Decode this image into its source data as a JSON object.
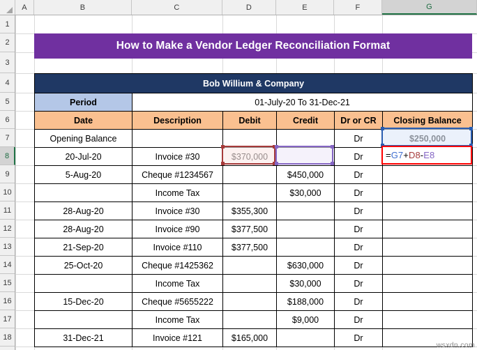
{
  "spreadsheet": {
    "column_headers": [
      "A",
      "B",
      "C",
      "D",
      "E",
      "F",
      "G"
    ],
    "active_column": "G",
    "active_row": "8",
    "row_headers": [
      "1",
      "2",
      "3",
      "4",
      "5",
      "6",
      "7",
      "8",
      "9",
      "10",
      "11",
      "12",
      "13",
      "14",
      "15",
      "16",
      "17",
      "18"
    ],
    "corner_select_all": "select-all-corner"
  },
  "banner": {
    "title": "How to Make a Vendor Ledger Reconciliation Format",
    "color": "#7030A0"
  },
  "table": {
    "company_name": "Bob Willium & Company",
    "company_bar_color": "#1F3864",
    "period_label": "Period",
    "period_label_color": "#B4C7E7",
    "period_value": "01-July-20 To 31-Dec-21",
    "header_color": "#FAC090",
    "columns": [
      "Date",
      "Description",
      "Debit",
      "Credit",
      "Dr or CR",
      "Closing Balance"
    ],
    "rows": [
      {
        "row": "7",
        "date": "Opening Balance",
        "description": "",
        "debit": "",
        "credit": "",
        "drcr": "Dr",
        "closing": "$250,000"
      },
      {
        "row": "8",
        "date": "20-Jul-20",
        "description": "Invoice #30",
        "debit": "$370,000",
        "credit": "",
        "drcr": "Dr",
        "closing": ""
      },
      {
        "row": "9",
        "date": "5-Aug-20",
        "description": "Cheque #1234567",
        "debit": "",
        "credit": "$450,000",
        "drcr": "Dr",
        "closing": ""
      },
      {
        "row": "10",
        "date": "",
        "description": "Income Tax",
        "debit": "",
        "credit": "$30,000",
        "drcr": "Dr",
        "closing": ""
      },
      {
        "row": "11",
        "date": "28-Aug-20",
        "description": "Invoice #30",
        "debit": "$355,300",
        "credit": "",
        "drcr": "Dr",
        "closing": ""
      },
      {
        "row": "12",
        "date": "28-Aug-20",
        "description": "Invoice #90",
        "debit": "$377,500",
        "credit": "",
        "drcr": "Dr",
        "closing": ""
      },
      {
        "row": "13",
        "date": "21-Sep-20",
        "description": "Invoice #110",
        "debit": "$377,500",
        "credit": "",
        "drcr": "Dr",
        "closing": ""
      },
      {
        "row": "14",
        "date": "25-Oct-20",
        "description": "Cheque #1425362",
        "debit": "",
        "credit": "$630,000",
        "drcr": "Dr",
        "closing": ""
      },
      {
        "row": "15",
        "date": "",
        "description": "Income Tax",
        "debit": "",
        "credit": "$30,000",
        "drcr": "Dr",
        "closing": ""
      },
      {
        "row": "16",
        "date": "15-Dec-20",
        "description": "Cheque #5655222",
        "debit": "",
        "credit": "$188,000",
        "drcr": "Dr",
        "closing": ""
      },
      {
        "row": "17",
        "date": "",
        "description": "Income Tax",
        "debit": "",
        "credit": "$9,000",
        "drcr": "Dr",
        "closing": ""
      },
      {
        "row": "18",
        "date": "31-Dec-21",
        "description": "Invoice #121",
        "debit": "$165,000",
        "credit": "",
        "drcr": "Dr",
        "closing": ""
      }
    ]
  },
  "formula": {
    "cell": "G8",
    "text": "=G7+D8-E8",
    "tokens": {
      "equals": "=",
      "ref1": "G7",
      "op1": "+",
      "ref2": "D8",
      "op2": "-",
      "ref3": "E8"
    },
    "token_colors": {
      "ref1": "#3F6FD0",
      "ref2": "#A63A3A",
      "ref3": "#8566C4"
    },
    "active_border_color": "#FF0000"
  },
  "references": {
    "g7": {
      "label": "G7",
      "color": "#2A5DB0"
    },
    "d8": {
      "label": "D8",
      "color": "#A63A3A"
    },
    "e8": {
      "label": "E8",
      "color": "#8566C4"
    }
  },
  "watermark": {
    "text": "wsxdn.com"
  }
}
